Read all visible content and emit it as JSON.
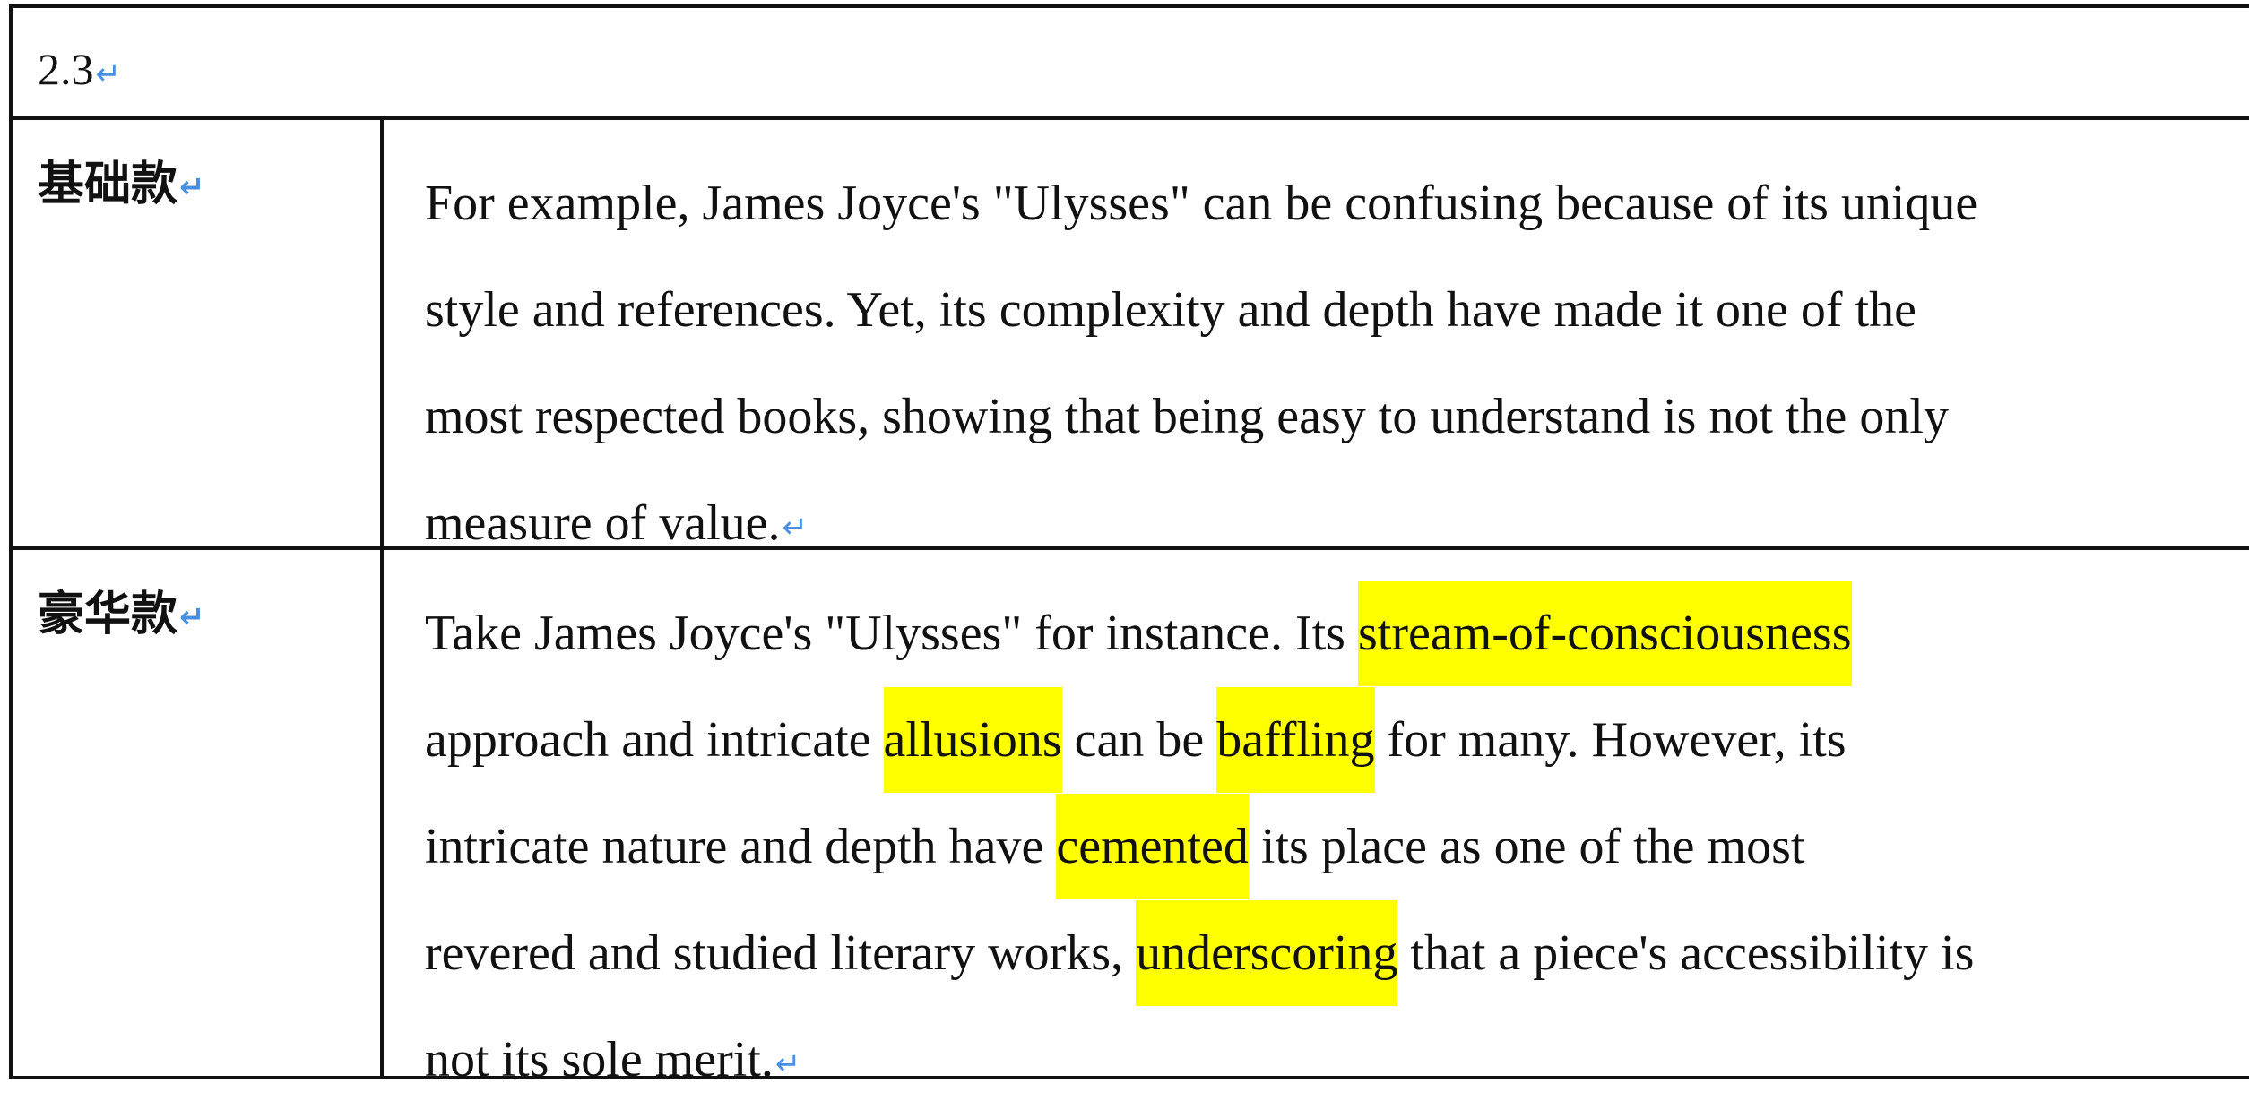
{
  "header": {
    "section_number": "2.3"
  },
  "paragraph_mark": "↵",
  "rows": [
    {
      "label": "基础款",
      "lines": [
        "For example, James Joyce's \"Ulysses\" can be confusing because of its unique",
        "style and references. Yet, its complexity and depth have made it one of the",
        "most respected books, showing that being easy to understand is not the only",
        "measure of value."
      ]
    },
    {
      "label": "豪华款",
      "lines": [
        {
          "pre": "Take James Joyce's \"Ulysses\" for instance. Its ",
          "hl": "stream-of-consciousness",
          "post": ""
        },
        {
          "pre": "approach and intricate ",
          "hl": "allusions",
          "mid": " can be ",
          "hl2": "baffling",
          "post": " for many. However, its"
        },
        {
          "pre": "intricate nature and depth have ",
          "hl": "cemented",
          "post": " its place as one of the most"
        },
        {
          "pre": "revered and studied literary works, ",
          "hl": "underscoring",
          "post": " that a piece's accessibility is"
        },
        {
          "pre": "not its sole merit.",
          "hl": "",
          "post": ""
        }
      ]
    }
  ],
  "highlight_color": "#ffff00",
  "paragraph_mark_color": "#4a90e2"
}
